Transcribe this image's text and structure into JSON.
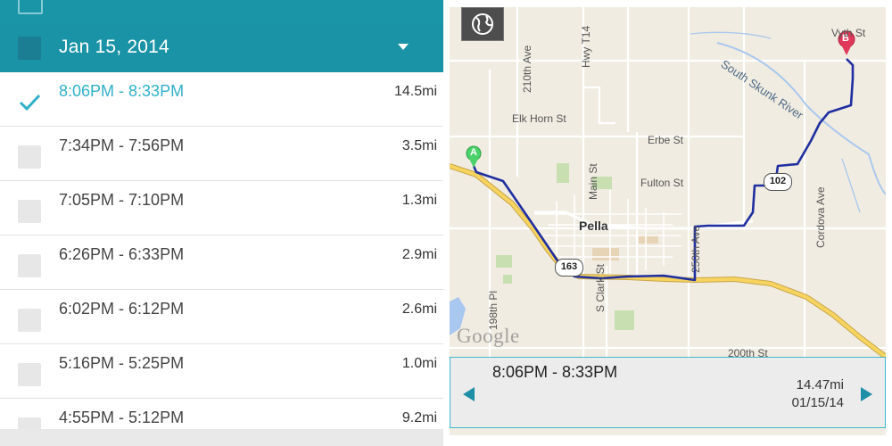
{
  "colors": {
    "header": "#1a93a6",
    "active_text": "#2fb0c8",
    "route": "#1f2fa0",
    "panel_border": "#41b8cc"
  },
  "list": {
    "date_header": "Jan 15, 2014",
    "expand_icon": "caret-down-icon",
    "trips": [
      {
        "time": "8:06PM - 8:33PM",
        "distance": "14.5mi",
        "checked": true
      },
      {
        "time": "7:34PM - 7:56PM",
        "distance": "3.5mi",
        "checked": false
      },
      {
        "time": "7:05PM - 7:10PM",
        "distance": "1.3mi",
        "checked": false
      },
      {
        "time": "6:26PM - 6:33PM",
        "distance": "2.9mi",
        "checked": false
      },
      {
        "time": "6:02PM - 6:12PM",
        "distance": "2.6mi",
        "checked": false
      },
      {
        "time": "5:16PM - 5:25PM",
        "distance": "1.0mi",
        "checked": false
      },
      {
        "time": "4:55PM - 5:12PM",
        "distance": "9.2mi",
        "checked": false
      }
    ]
  },
  "map": {
    "globe_icon": "globe-icon",
    "labels": {
      "ave_210": "210th Ave",
      "hwy_t14": "Hwy T14",
      "elk_horn": "Elk Horn St",
      "erbe": "Erbe St",
      "fulton": "Fulton St",
      "main": "Main St",
      "pella": "Pella",
      "ave_250": "250th Ave",
      "s_clark": "S Clark St",
      "cordova": "Cordova Ave",
      "st_200": "200th St",
      "pl_198": "198th Pl",
      "top_st": "Vyth St",
      "river": "South Skunk River"
    },
    "shields": {
      "hwy_163": "163",
      "hwy_102": "102"
    },
    "marker_start": "A",
    "marker_end": "B",
    "logo": "Google"
  },
  "trip_panel": {
    "time": "8:06PM - 8:33PM",
    "distance": "14.47mi",
    "date": "01/15/14"
  }
}
